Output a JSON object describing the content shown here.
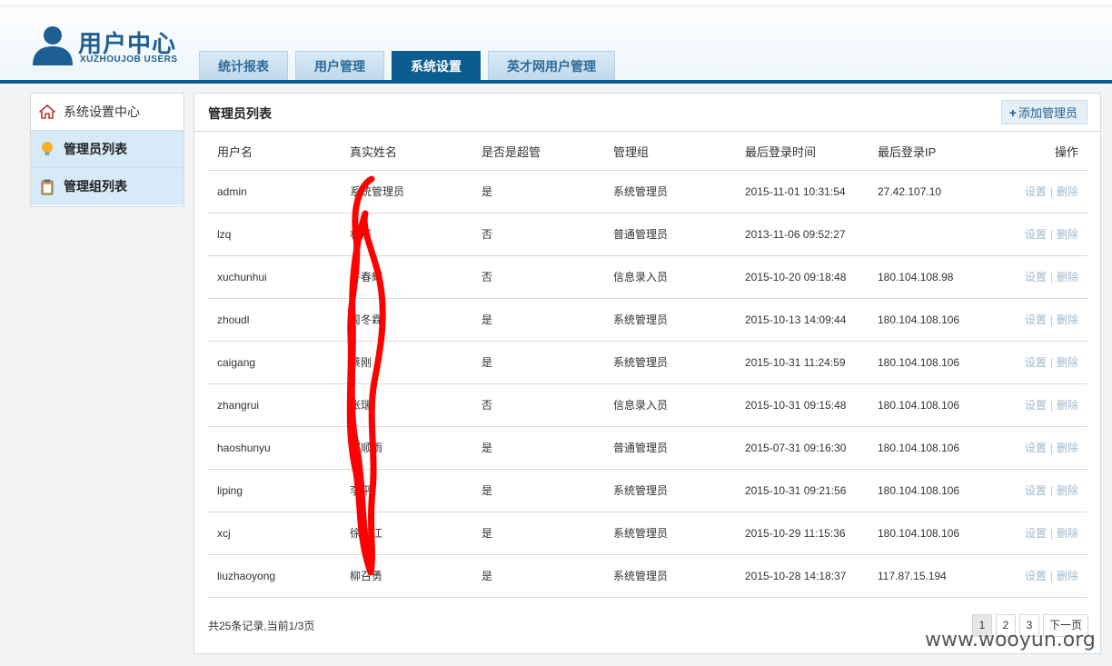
{
  "logo": {
    "title": "用户中心",
    "subtitle": "XUZHOUJOB USERS"
  },
  "tabs": [
    "统计报表",
    "用户管理",
    "系统设置",
    "英才网用户管理"
  ],
  "active_tab": 2,
  "sidebar": {
    "heading": "系统设置中心",
    "items": [
      {
        "label": "管理员列表",
        "icon": "bulb-icon"
      },
      {
        "label": "管理组列表",
        "icon": "clipboard-icon"
      }
    ]
  },
  "panel": {
    "title": "管理员列表",
    "add_button": "添加管理员"
  },
  "table": {
    "columns": [
      "用户名",
      "真实姓名",
      "是否是超管",
      "管理组",
      "最后登录时间",
      "最后登录IP",
      "操作"
    ],
    "rows": [
      {
        "username": "admin",
        "realname": "系统管理员",
        "super": "是",
        "group": "系统管理员",
        "time": "2015-11-01 10:31:54",
        "ip": "27.42.107.10"
      },
      {
        "username": "lzq",
        "realname": "林芹",
        "super": "否",
        "group": "普通管理员",
        "time": "2013-11-06 09:52:27",
        "ip": ""
      },
      {
        "username": "xuchunhui",
        "realname": "许春辉",
        "super": "否",
        "group": "信息录入员",
        "time": "2015-10-20 09:18:48",
        "ip": "180.104.108.98"
      },
      {
        "username": "zhoudl",
        "realname": "周冬霖",
        "super": "是",
        "group": "系统管理员",
        "time": "2015-10-13 14:09:44",
        "ip": "180.104.108.106"
      },
      {
        "username": "caigang",
        "realname": "蔡刚",
        "super": "是",
        "group": "系统管理员",
        "time": "2015-10-31 11:24:59",
        "ip": "180.104.108.106"
      },
      {
        "username": "zhangrui",
        "realname": "张瑞",
        "super": "否",
        "group": "信息录入员",
        "time": "2015-10-31 09:15:48",
        "ip": "180.104.108.106"
      },
      {
        "username": "haoshunyu",
        "realname": "郝顺雨",
        "super": "是",
        "group": "普通管理员",
        "time": "2015-07-31 09:16:30",
        "ip": "180.104.108.106"
      },
      {
        "username": "liping",
        "realname": "李平",
        "super": "是",
        "group": "系统管理员",
        "time": "2015-10-31 09:21:56",
        "ip": "180.104.108.106"
      },
      {
        "username": "xcj",
        "realname": "徐长江",
        "super": "是",
        "group": "系统管理员",
        "time": "2015-10-29 11:15:36",
        "ip": "180.104.108.106"
      },
      {
        "username": "liuzhaoyong",
        "realname": "柳召勇",
        "super": "是",
        "group": "系统管理员",
        "time": "2015-10-28 14:18:37",
        "ip": "117.87.15.194"
      }
    ],
    "action_edit": "设置",
    "action_delete": "删除",
    "action_sep": "|"
  },
  "pagination": {
    "summary": "共25条记录,当前1/3页",
    "pages": [
      "1",
      "2",
      "3"
    ],
    "next": "下一页",
    "current": 0
  },
  "watermark": "www.wooyun.org",
  "colors": {
    "brand": "#0a5c91",
    "scribble": "#ff0000"
  }
}
